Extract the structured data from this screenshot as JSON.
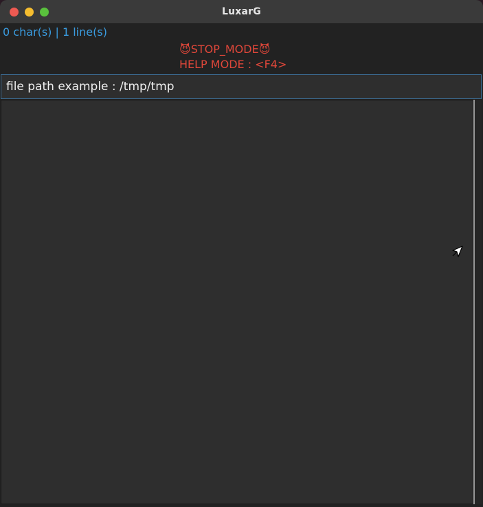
{
  "window": {
    "title": "LuxarG"
  },
  "status": {
    "counts": "0 char(s) | 1 line(s)"
  },
  "mode": {
    "stop_icon": "devil-face-icon",
    "stop_label": "STOP_MODE",
    "help_label": "HELP MODE : <F4>"
  },
  "path_input": {
    "placeholder": "file path example : /tmp/tmp",
    "value": ""
  },
  "colors": {
    "status_text": "#3a9ce0",
    "mode_text": "#e0473a",
    "input_border": "#3c6e96"
  }
}
